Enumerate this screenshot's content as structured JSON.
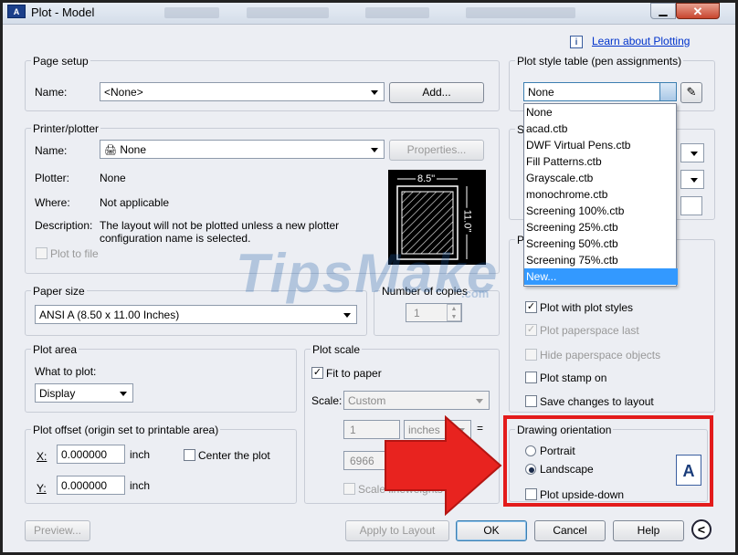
{
  "window": {
    "title": "Plot - Model",
    "app_icon": "AutoCAD",
    "close_label": "✕",
    "min_label": "▁",
    "learn_link": "Learn about Plotting"
  },
  "page_setup": {
    "title": "Page setup",
    "name_label": "Name:",
    "name_value": "<None>",
    "add_label": "Add..."
  },
  "printer": {
    "title": "Printer/plotter",
    "name_label": "Name:",
    "name_value": "None",
    "properties_label": "Properties...",
    "plotter_label": "Plotter:",
    "plotter_value": "None",
    "where_label": "Where:",
    "where_value": "Not applicable",
    "description_label": "Description:",
    "description_line1": "The layout will not be plotted unless a new plotter",
    "description_line2": "configuration name is selected.",
    "plot_to_file_label": "Plot to file",
    "preview_width": "8.5\"",
    "preview_height": "11.0\""
  },
  "paper_size": {
    "title": "Paper size",
    "value": "ANSI A (8.50 x 11.00 Inches)"
  },
  "copies": {
    "title": "Number of copies",
    "value": "1"
  },
  "plot_area": {
    "title": "Plot area",
    "what_label": "What to plot:",
    "what_value": "Display"
  },
  "plot_scale": {
    "title": "Plot scale",
    "fit_label": "Fit to paper",
    "scale_label": "Scale:",
    "scale_value": "Custom",
    "num_value": "1",
    "unit_value": "inches",
    "eq": "=",
    "den_value": "6966",
    "lineweights_label": "Scale lineweights"
  },
  "plot_offset": {
    "title": "Plot offset (origin set to printable area)",
    "x_label": "X:",
    "x_value": "0.000000",
    "x_unit": "inch",
    "y_label": "Y:",
    "y_value": "0.000000",
    "y_unit": "inch",
    "center_label": "Center the plot"
  },
  "plot_style": {
    "title": "Plot style table (pen assignments)",
    "value": "None",
    "options": [
      "None",
      "acad.ctb",
      "DWF Virtual Pens.ctb",
      "Fill Patterns.ctb",
      "Grayscale.ctb",
      "monochrome.ctb",
      "Screening 100%.ctb",
      "Screening 25%.ctb",
      "Screening 50%.ctb",
      "Screening 75%.ctb",
      "New..."
    ],
    "shaded_partial": "Sh",
    "options_partial": "Pl"
  },
  "plot_options": {
    "with_styles": "Plot with plot styles",
    "paperspace_last": "Plot paperspace last",
    "hide_objects": "Hide paperspace objects",
    "stamp": "Plot stamp on",
    "save_changes": "Save changes to layout"
  },
  "orientation": {
    "title": "Drawing orientation",
    "portrait": "Portrait",
    "landscape": "Landscape",
    "upside_down": "Plot upside-down",
    "preview_letter": "A"
  },
  "footer": {
    "preview_label": "Preview...",
    "apply_label": "Apply to Layout",
    "ok_label": "OK",
    "cancel_label": "Cancel",
    "help_label": "Help",
    "more_label": "<"
  },
  "watermark": {
    "text": "TipsMake",
    "sub": ".com"
  },
  "colors": {
    "highlight_box": "#e31b1b",
    "selection": "#3399ff",
    "link": "#0033cc"
  }
}
